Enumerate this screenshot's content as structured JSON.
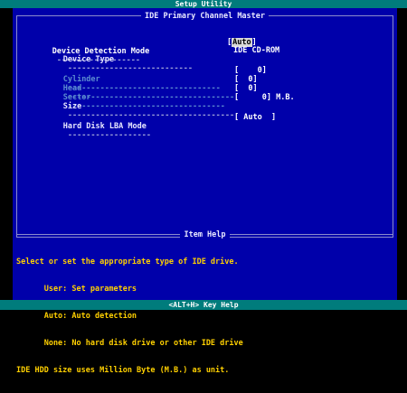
{
  "header": {
    "title": "Setup Utility"
  },
  "section": {
    "title": "IDE Primary Channel Master"
  },
  "fields": {
    "detection_mode": {
      "label": "Device Detection Mode",
      "value": "Auto"
    },
    "device_type": {
      "label": "Device Type",
      "value": "IDE CD-ROM"
    },
    "cylinder": {
      "label": "Cylinder",
      "value": "0"
    },
    "head": {
      "label": "Head",
      "value": "0"
    },
    "sector": {
      "label": "Sector",
      "value": "0"
    },
    "size": {
      "label": "Size",
      "value": "0",
      "unit": "M.B."
    },
    "lba_mode": {
      "label": "Hard Disk LBA Mode",
      "value": "Auto"
    }
  },
  "help": {
    "title": "Item Help",
    "lines": [
      "Select or set the appropriate type of IDE drive.",
      "      User: Set parameters",
      "      Auto: Auto detection",
      "      None: No hard disk drive or other IDE drive",
      "IDE HDD size uses Million Byte (M.B.) as unit."
    ]
  },
  "footer": {
    "hint": "<ALT+H>  Key Help"
  }
}
